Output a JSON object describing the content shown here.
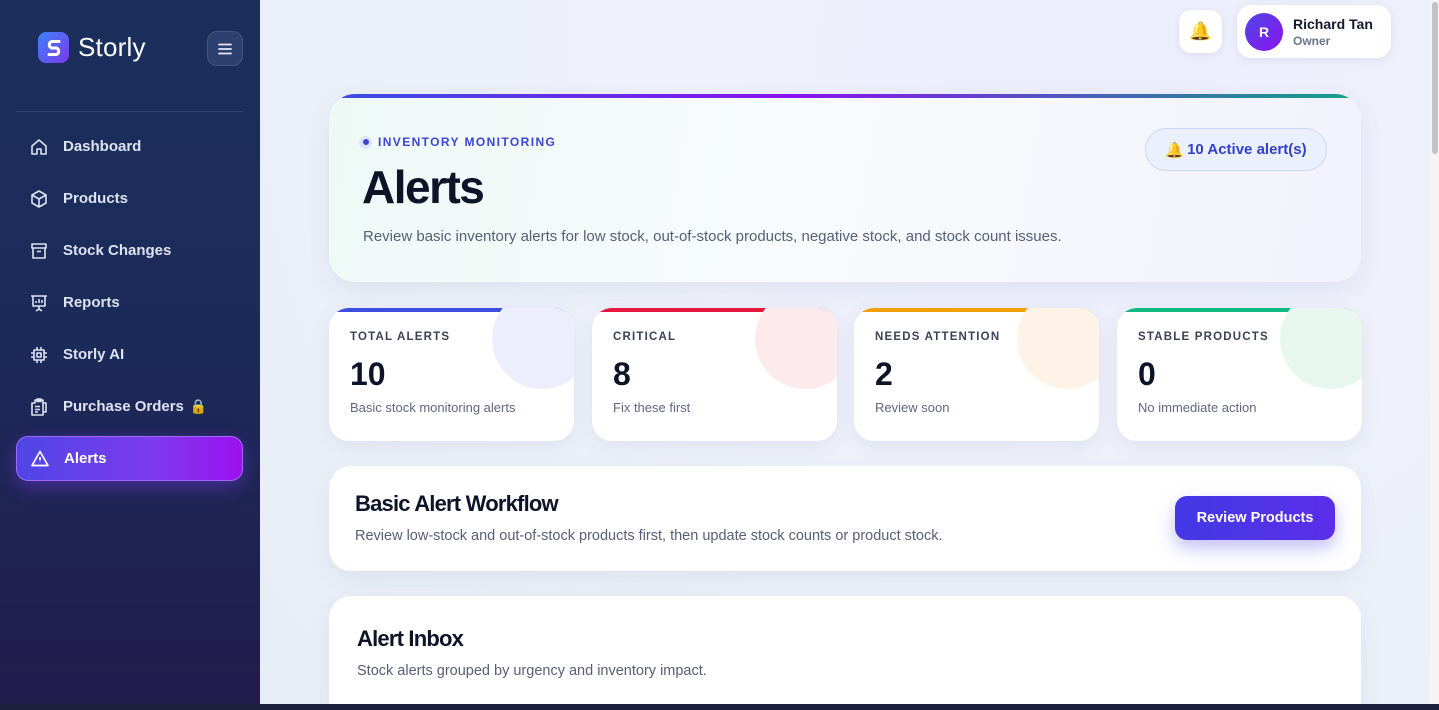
{
  "brand": {
    "name": "Storly"
  },
  "sidebar": {
    "items": [
      {
        "label": "Dashboard",
        "icon": "home-icon"
      },
      {
        "label": "Products",
        "icon": "box-icon"
      },
      {
        "label": "Stock Changes",
        "icon": "archive-icon"
      },
      {
        "label": "Reports",
        "icon": "presentation-chart-icon"
      },
      {
        "label": "Storly AI",
        "icon": "chip-icon"
      },
      {
        "label": "Purchase Orders",
        "icon": "clipboard-icon",
        "badge": "🔒"
      },
      {
        "label": "Alerts",
        "icon": "warning-triangle-icon",
        "active": true
      }
    ]
  },
  "header": {
    "notification_icon": "🔔",
    "user": {
      "initial": "R",
      "name": "Richard Tan",
      "role": "Owner"
    }
  },
  "hero": {
    "eyebrow": "INVENTORY MONITORING",
    "title": "Alerts",
    "subtitle": "Review basic inventory alerts for low stock, out-of-stock products, negative stock, and stock count issues.",
    "pill_icon": "🔔",
    "pill_label": "10 Active alert(s)"
  },
  "stats": [
    {
      "label": "TOTAL ALERTS",
      "value": "10",
      "sub": "Basic stock monitoring alerts",
      "color": "#3b4ee0",
      "tint": "#eceefb"
    },
    {
      "label": "CRITICAL",
      "value": "8",
      "sub": "Fix these first",
      "color": "#e5173f",
      "tint": "#fdeaec"
    },
    {
      "label": "NEEDS ATTENTION",
      "value": "2",
      "sub": "Review soon",
      "color": "#f59e0b",
      "tint": "#fef3e6"
    },
    {
      "label": "STABLE PRODUCTS",
      "value": "0",
      "sub": "No immediate action",
      "color": "#10b981",
      "tint": "#e7f7ef"
    }
  ],
  "workflow": {
    "title": "Basic Alert Workflow",
    "subtitle": "Review low-stock and out-of-stock products first, then update stock counts or product stock.",
    "button_label": "Review Products"
  },
  "inbox": {
    "title": "Alert Inbox",
    "subtitle": "Stock alerts grouped by urgency and inventory impact."
  }
}
